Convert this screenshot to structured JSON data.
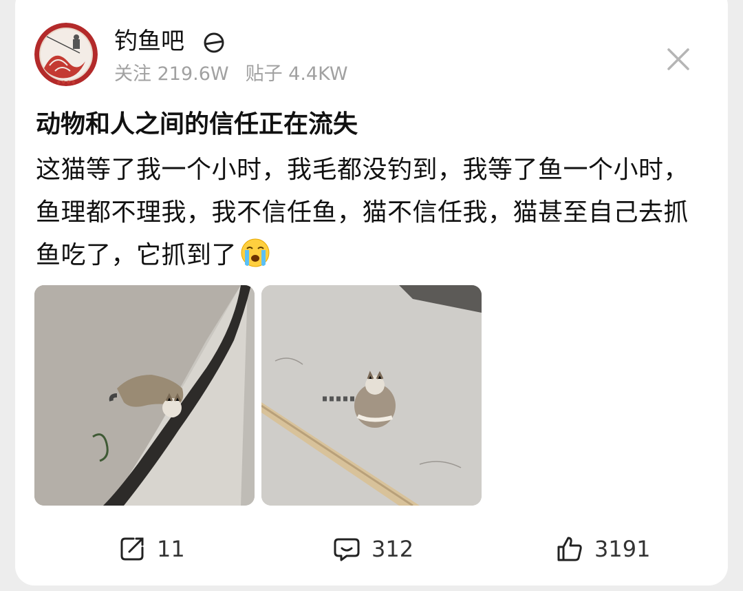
{
  "forum": {
    "name": "钓鱼吧",
    "followers_label": "关注 219.6W",
    "posts_label": "贴子 4.4KW",
    "avatar_icon": "fishing-forum-logo",
    "badge_icon": "verified-badge-icon"
  },
  "post": {
    "title": "动物和人之间的信任正在流失",
    "body": "这猫等了我一个小时，我毛都没钓到，我等了鱼一个小时，鱼理都不理我，我不信任鱼，猫不信任我，猫甚至自己去抓鱼吃了，它抓到了",
    "emoji": "crying-face-emoji",
    "images": [
      {
        "name": "cat-at-water-photo"
      },
      {
        "name": "cat-eating-fish-photo"
      }
    ]
  },
  "actions": {
    "share_count": "11",
    "comment_count": "312",
    "like_count": "3191"
  },
  "colors": {
    "background": "#ededed",
    "card": "#ffffff",
    "muted_text": "#a1a1a1",
    "avatar_red": "#b32a2a"
  }
}
